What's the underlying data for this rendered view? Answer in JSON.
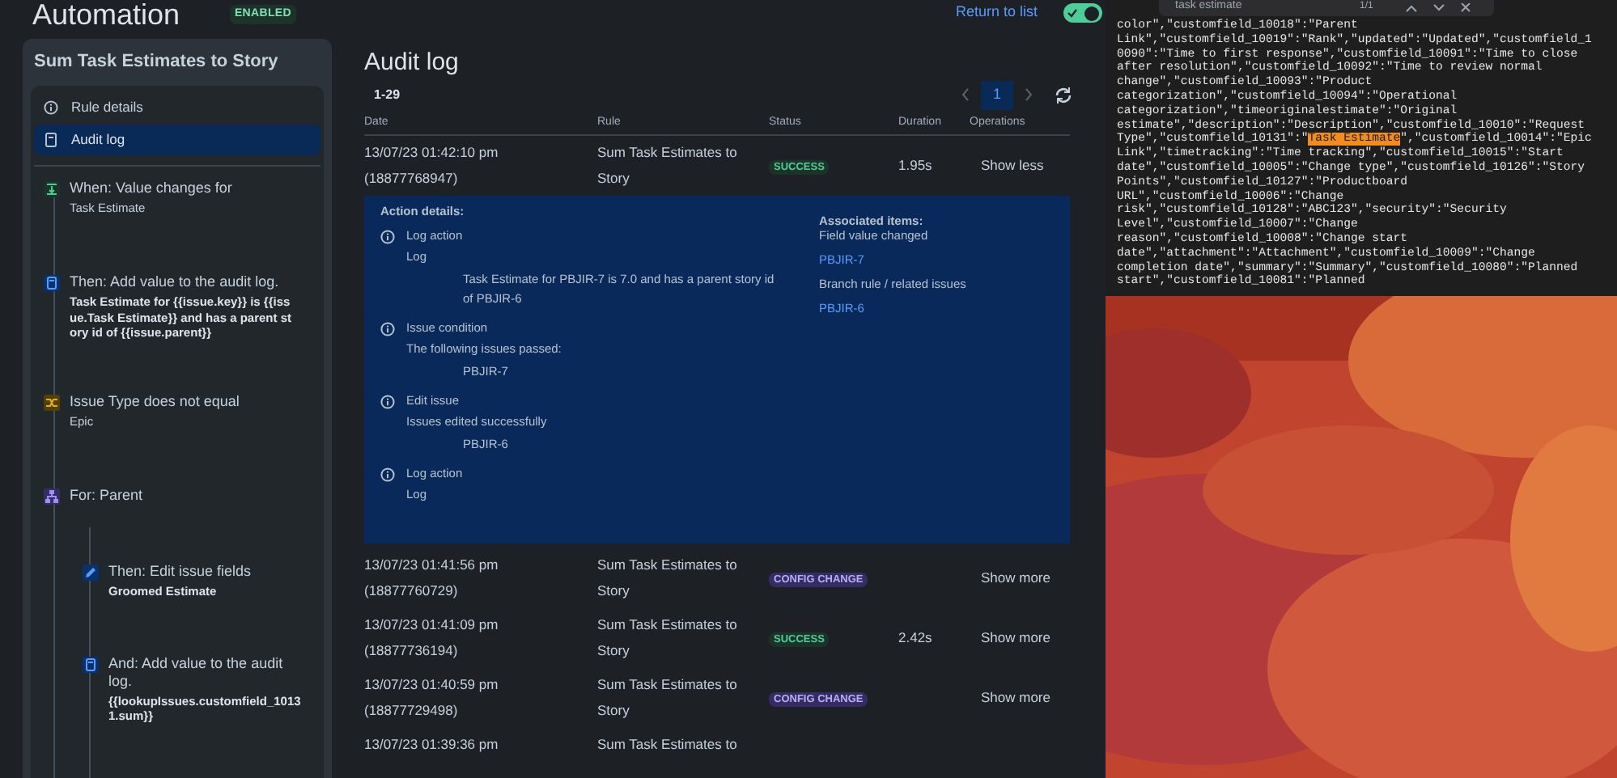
{
  "header": {
    "title": "Automation",
    "badge": "ENABLED",
    "return_link": "Return to list",
    "toggle_on": true
  },
  "rule": {
    "title": "Sum Task Estimates to Story",
    "nav": [
      {
        "label": "Rule details",
        "selected": false
      },
      {
        "label": "Audit log",
        "selected": true
      }
    ],
    "steps": [
      {
        "kind": "trigger",
        "title": "When: Value changes for",
        "detail": "Task Estimate"
      },
      {
        "kind": "action",
        "title": "Then: Add value to the audit log.",
        "detail": "Task Estimate for {{issue.key}} is {{issue.Task Estimate}} and has a parent story id of {{issue.parent}}"
      },
      {
        "kind": "condition",
        "title": "Issue Type does not equal",
        "detail": "Epic"
      },
      {
        "kind": "branch",
        "title": "For: Parent",
        "children": [
          {
            "kind": "edit",
            "title": "Then: Edit issue fields",
            "detail": "Groomed Estimate"
          },
          {
            "kind": "action",
            "title": "And: Add value to the audit log.",
            "detail": "{{lookupIssues.customfield_10131.sum}}"
          }
        ]
      }
    ]
  },
  "audit": {
    "title": "Audit log",
    "range": "1-29",
    "pagination": {
      "pages": [
        {
          "label": "1",
          "selected": true
        }
      ]
    },
    "columns": [
      "Date",
      "Rule",
      "Status",
      "Duration",
      "Operations"
    ],
    "rows": [
      {
        "date": "13/07/23 01:42:10 pm",
        "id": "(18877768947)",
        "rule": "Sum Task Estimates to",
        "rule_2": "Story",
        "status": {
          "label": "SUCCESS",
          "kind": "success"
        },
        "duration": "1.95s",
        "operation": "Show less",
        "details": {
          "heading": "Action details:",
          "actions": [
            {
              "title": "Log action",
              "sub": "Log",
              "item": "Task Estimate for PBJIR-7 is 7.0 and has a parent story id of PBJIR-6"
            },
            {
              "title": "Issue condition",
              "sub": "The following issues passed:",
              "item": "PBJIR-7"
            },
            {
              "title": "Edit issue",
              "sub": "Issues edited successfully",
              "item": "PBJIR-6"
            },
            {
              "title": "Log action",
              "sub": "Log"
            }
          ],
          "associated": {
            "heading": "Associated items:",
            "groups": [
              {
                "label": "Field value changed",
                "link": "PBJIR-7"
              },
              {
                "label": "Branch rule / related issues",
                "link": "PBJIR-6"
              }
            ]
          }
        }
      },
      {
        "date": "13/07/23 01:41:56 pm",
        "id": "(18877760729)",
        "rule": "Sum Task Estimates to",
        "rule_2": "Story",
        "status": {
          "label": "CONFIG CHANGE",
          "kind": "config"
        },
        "operation": "Show more"
      },
      {
        "date": "13/07/23 01:41:09 pm",
        "id": "(18877736194)",
        "rule": "Sum Task Estimates to",
        "rule_2": "Story",
        "status": {
          "label": "SUCCESS",
          "kind": "success"
        },
        "duration": "2.42s",
        "operation": "Show more"
      },
      {
        "date": "13/07/23 01:40:59 pm",
        "id": "(18877729498)",
        "rule": "Sum Task Estimates to",
        "rule_2": "Story",
        "status": {
          "label": "CONFIG CHANGE",
          "kind": "config"
        },
        "operation": "Show more"
      },
      {
        "date": "13/07/23 01:39:36 pm",
        "rule": "Sum Task Estimates to"
      }
    ]
  },
  "viewer": {
    "find": {
      "query": "task estimate",
      "count": "1/1"
    },
    "lines": [
      {
        "text": "color\",\"customfield_10018\":\"Parent"
      },
      {
        "text": "Link\",\"customfield_10019\":\"Rank\",\"updated\":\"Updated\",\"customfield_1"
      },
      {
        "text": "0090\":\"Time to first response\",\"customfield_10091\":\"Time to close"
      },
      {
        "text": "after resolution\",\"customfield_10092\":\"Time to review normal"
      },
      {
        "text": "change\",\"customfield_10093\":\"Product"
      },
      {
        "text": "categorization\",\"customfield_10094\":\"Operational"
      },
      {
        "text": "categorization\",\"timeoriginalestimate\":\"Original"
      },
      {
        "text": "estimate\",\"description\":\"Description\",\"customfield_10010\":\"Request"
      },
      {
        "text": "Type\",\"customfield_10131\":\"",
        "match": "Task Estimate",
        "after": "\",\"customfield_10014\":\"Epic"
      },
      {
        "text": "Link\",\"timetracking\":\"Time tracking\",\"customfield_10015\":\"Start"
      },
      {
        "text": "date\",\"customfield_10005\":\"Change type\",\"customfield_10126\":\"Story"
      },
      {
        "text": "Points\",\"customfield_10127\":\"Productboard"
      },
      {
        "text": "URL\",\"customfield_10006\":\"Change"
      },
      {
        "text": "risk\",\"customfield_10128\":\"ABC123\",\"security\":\"Security"
      },
      {
        "text": "Level\",\"customfield_10007\":\"Change"
      },
      {
        "text": "reason\",\"customfield_10008\":\"Change start"
      },
      {
        "text": "date\",\"attachment\":\"Attachment\",\"customfield_10009\":\"Change"
      },
      {
        "text": "completion date\",\"summary\":\"Summary\",\"customfield_10080\":\"Planned"
      },
      {
        "text": "start\",\"customfield_10081\":\"Planned"
      }
    ]
  }
}
